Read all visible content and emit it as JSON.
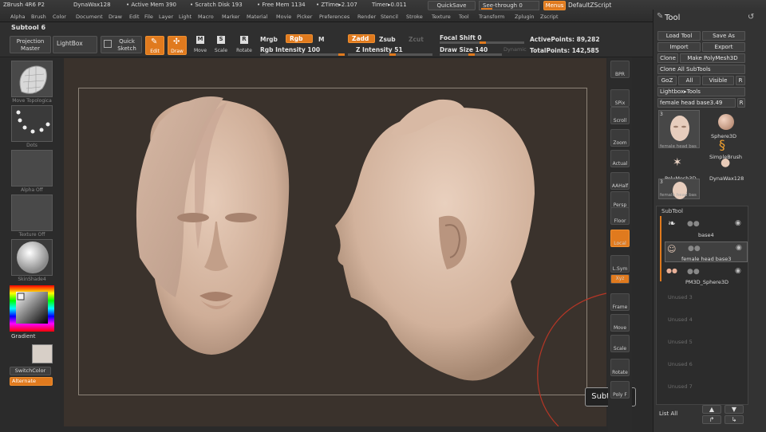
{
  "menubar": {
    "app_title": "ZBrush 4R6 P2",
    "tool_name": "DynaWax128",
    "active_mem": "• Active Mem 390",
    "scratch_disk": "• Scratch Disk 193",
    "free_mem": "• Free Mem 1134",
    "ztime": "• ZTime▸2.107",
    "timer": "Timer▸0.011",
    "quicksave": "QuickSave",
    "see_through": "See-through",
    "see_through_val": "0",
    "menus": "Menus",
    "default_script": "DefaultZScript",
    "items": [
      "Alpha",
      "Brush",
      "Color",
      "Document",
      "Draw",
      "Edit",
      "File",
      "Layer",
      "Light",
      "Macro",
      "Marker",
      "Material",
      "Movie",
      "Picker",
      "Preferences",
      "Render",
      "Stencil",
      "Stroke",
      "Texture",
      "Tool",
      "Transform",
      "Zplugin",
      "Zscript"
    ]
  },
  "toolbar": {
    "subtool_title": "Subtool 6",
    "projection_master": "Projection Master",
    "lightbox": "LightBox",
    "quick_sketch": "Quick Sketch",
    "edit": "Edit",
    "draw": "Draw",
    "move": "Move",
    "scale": "Scale",
    "rotate": "Rotate",
    "mrgb": "Mrgb",
    "rgb": "Rgb",
    "m": "M",
    "rgb_intensity": "Rgb Intensity 100",
    "zadd": "Zadd",
    "zsub": "Zsub",
    "zcut": "Zcut",
    "z_intensity": "Z Intensity 51",
    "focal_shift": "Focal Shift 0",
    "draw_size": "Draw Size 140",
    "dynamic": "Dynamic",
    "active_points": "ActivePoints: 89,282",
    "total_points": "TotalPoints: 142,585"
  },
  "left_shelf": {
    "thumbs": [
      "Move Topologica",
      "Dots",
      "Alpha Off",
      "Texture Off",
      "SkinShade4"
    ],
    "gradient": "Gradient",
    "switch_color": "SwitchColor",
    "alternate": "Alternate"
  },
  "right_shelf": {
    "buttons": [
      "BPR",
      "SPix",
      "Scroll",
      "Zoom",
      "Actual",
      "AAHalf",
      "Persp",
      "Floor",
      "Local",
      "L.Sym",
      "Xyz",
      "Frame",
      "Move",
      "Scale",
      "Rotate",
      "Poly F"
    ]
  },
  "tool_panel": {
    "title": "Tool",
    "load_tool": "Load Tool",
    "save_as": "Save As",
    "import": "Import",
    "export": "Export",
    "clone": "Clone",
    "make_polymesh": "Make PolyMesh3D",
    "clone_all_subtools": "Clone All SubTools",
    "goz": "GoZ",
    "all": "All",
    "visible": "Visible",
    "r": "R",
    "lightbox_tools": "Lightbox▸Tools",
    "current_tool": "female head base3.",
    "current_tool_val": "49",
    "current_tool_r": "R",
    "tool_thumbs": [
      {
        "name": "female head bas",
        "count": "3"
      },
      {
        "name": "Sphere3D",
        "count": ""
      },
      {
        "name": "SimpleBrush",
        "count": ""
      },
      {
        "name": "PolyMesh3D",
        "count": ""
      },
      {
        "name": "DynaWax128",
        "count": ""
      },
      {
        "name": "female head bas",
        "count": "3"
      }
    ],
    "subtool_header": "SubTool",
    "subtools": [
      "base4",
      "female head base3",
      "PM3D_Sphere3D"
    ],
    "unused": [
      "Unused 3",
      "Unused 4",
      "Unused 5",
      "Unused 6",
      "Unused 7"
    ],
    "list_all": "List All"
  },
  "canvas": {
    "subtool_badge": "Subtool 6"
  },
  "colors": {
    "accent": "#e07a1e",
    "canvas_bg": "#3a322c",
    "skin": "#d9b9a4"
  }
}
